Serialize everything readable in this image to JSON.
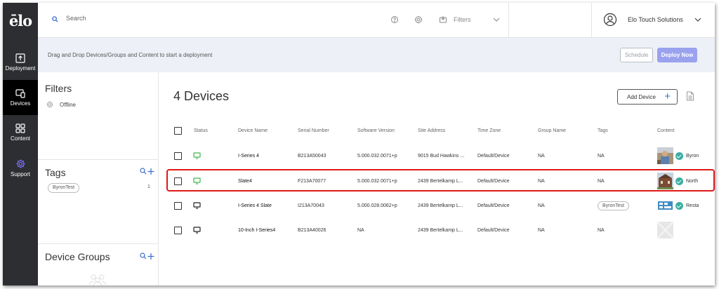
{
  "brand": {
    "logo": "ēlo"
  },
  "rail": [
    {
      "label": "Deployment",
      "icon": "deploy-upload-icon"
    },
    {
      "label": "Devices",
      "icon": "devices-icon",
      "active": true
    },
    {
      "label": "Content",
      "icon": "content-grid-icon"
    },
    {
      "label": "Support",
      "icon": "support-gear-icon"
    }
  ],
  "topbar": {
    "search_placeholder": "Search",
    "filters_label": "Filters",
    "user_name": "Elo Touch Solutions"
  },
  "banner": {
    "text": "Drag and Drop Devices/Groups and Content to start a deployment",
    "schedule_label": "Schedule",
    "deploy_label": "Deploy Now"
  },
  "panel": {
    "filters_title": "Filters",
    "filter_item": "Offline",
    "tags_title": "Tags",
    "tag": "ByronTest",
    "tag_count": "1",
    "groups_title": "Device Groups"
  },
  "main": {
    "title": "4 Devices",
    "add_device_label": "Add Device",
    "add_plus": "+",
    "columns": [
      "Status",
      "Device Name",
      "Serial Number",
      "Software Version",
      "Site Address",
      "Time Zone",
      "Group Name",
      "Tags",
      "Content"
    ],
    "rows": [
      {
        "status": "online",
        "name": "I-Series 4",
        "serial": "B213A50043",
        "software": "5.000.032.0071+p",
        "site": "9015 Bud Hawkins ...",
        "tz": "Default/Device",
        "group": "NA",
        "tags": "NA",
        "content": "Byron",
        "thumb": "person"
      },
      {
        "status": "online",
        "name": "Slate4",
        "serial": "F213A70077",
        "software": "5.000.032.0071+p",
        "site": "2439 Bertelkamp L...",
        "tz": "Default/Device",
        "group": "NA",
        "tags": "NA",
        "content": "North",
        "thumb": "building"
      },
      {
        "status": "offline",
        "name": "I-Series 4 Slate",
        "serial": "I213A70043",
        "software": "5.000.028.0062+p",
        "site": "2439 Bertelkamp L...",
        "tz": "Default/Device",
        "group": "NA",
        "tags": "ByronTest",
        "content": "Resta",
        "thumb": "sign"
      },
      {
        "status": "offline",
        "name": "10-Inch I-Series4",
        "serial": "B213A40026",
        "software": "NA",
        "site": "2439 Bertelkamp L...",
        "tz": "Default/Device",
        "group": "NA",
        "tags": "NA",
        "content": "",
        "thumb": "empty"
      }
    ]
  },
  "colors": {
    "rail": "#2d2e31",
    "accent": "#3a6cc9",
    "online": "#3db84a",
    "highlight": "#e01818",
    "deploy": "#9aa2ee"
  }
}
